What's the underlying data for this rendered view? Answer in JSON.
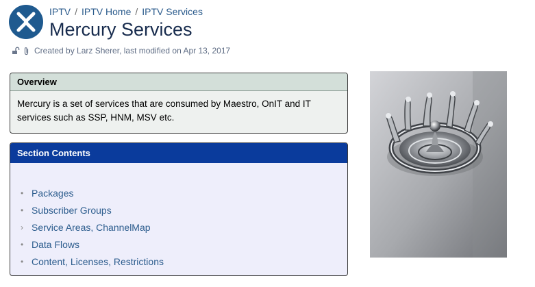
{
  "breadcrumbs": [
    {
      "label": "IPTV"
    },
    {
      "label": "IPTV Home"
    },
    {
      "label": "IPTV Services"
    }
  ],
  "breadcrumb_separator": "/",
  "page": {
    "title": "Mercury Services",
    "meta": "Created by Larz Sherer, last modified on Apr 13, 2017"
  },
  "overview": {
    "heading": "Overview",
    "body": "Mercury is a set of services that are consumed by Maestro, OnIT and IT services such as SSP, HNM, MSV etc."
  },
  "section_contents": {
    "heading": "Section Contents",
    "items": [
      {
        "label": "Packages",
        "bullet": "•"
      },
      {
        "label": "Subscriber Groups",
        "bullet": "•"
      },
      {
        "label": "Service Areas, ChannelMap",
        "bullet": "›"
      },
      {
        "label": "Data Flows",
        "bullet": "•"
      },
      {
        "label": "Content, Licenses, Restrictions",
        "bullet": "•"
      }
    ]
  },
  "icons": {
    "space_logo": "space-logo-icon",
    "restrictions": "unlock-icon",
    "attachment": "paperclip-icon"
  },
  "colors": {
    "link": "#2b5b8c",
    "overview_header": "#d3dfd9",
    "contents_header": "#0a3b9c",
    "contents_bg": "#eeeefb"
  }
}
